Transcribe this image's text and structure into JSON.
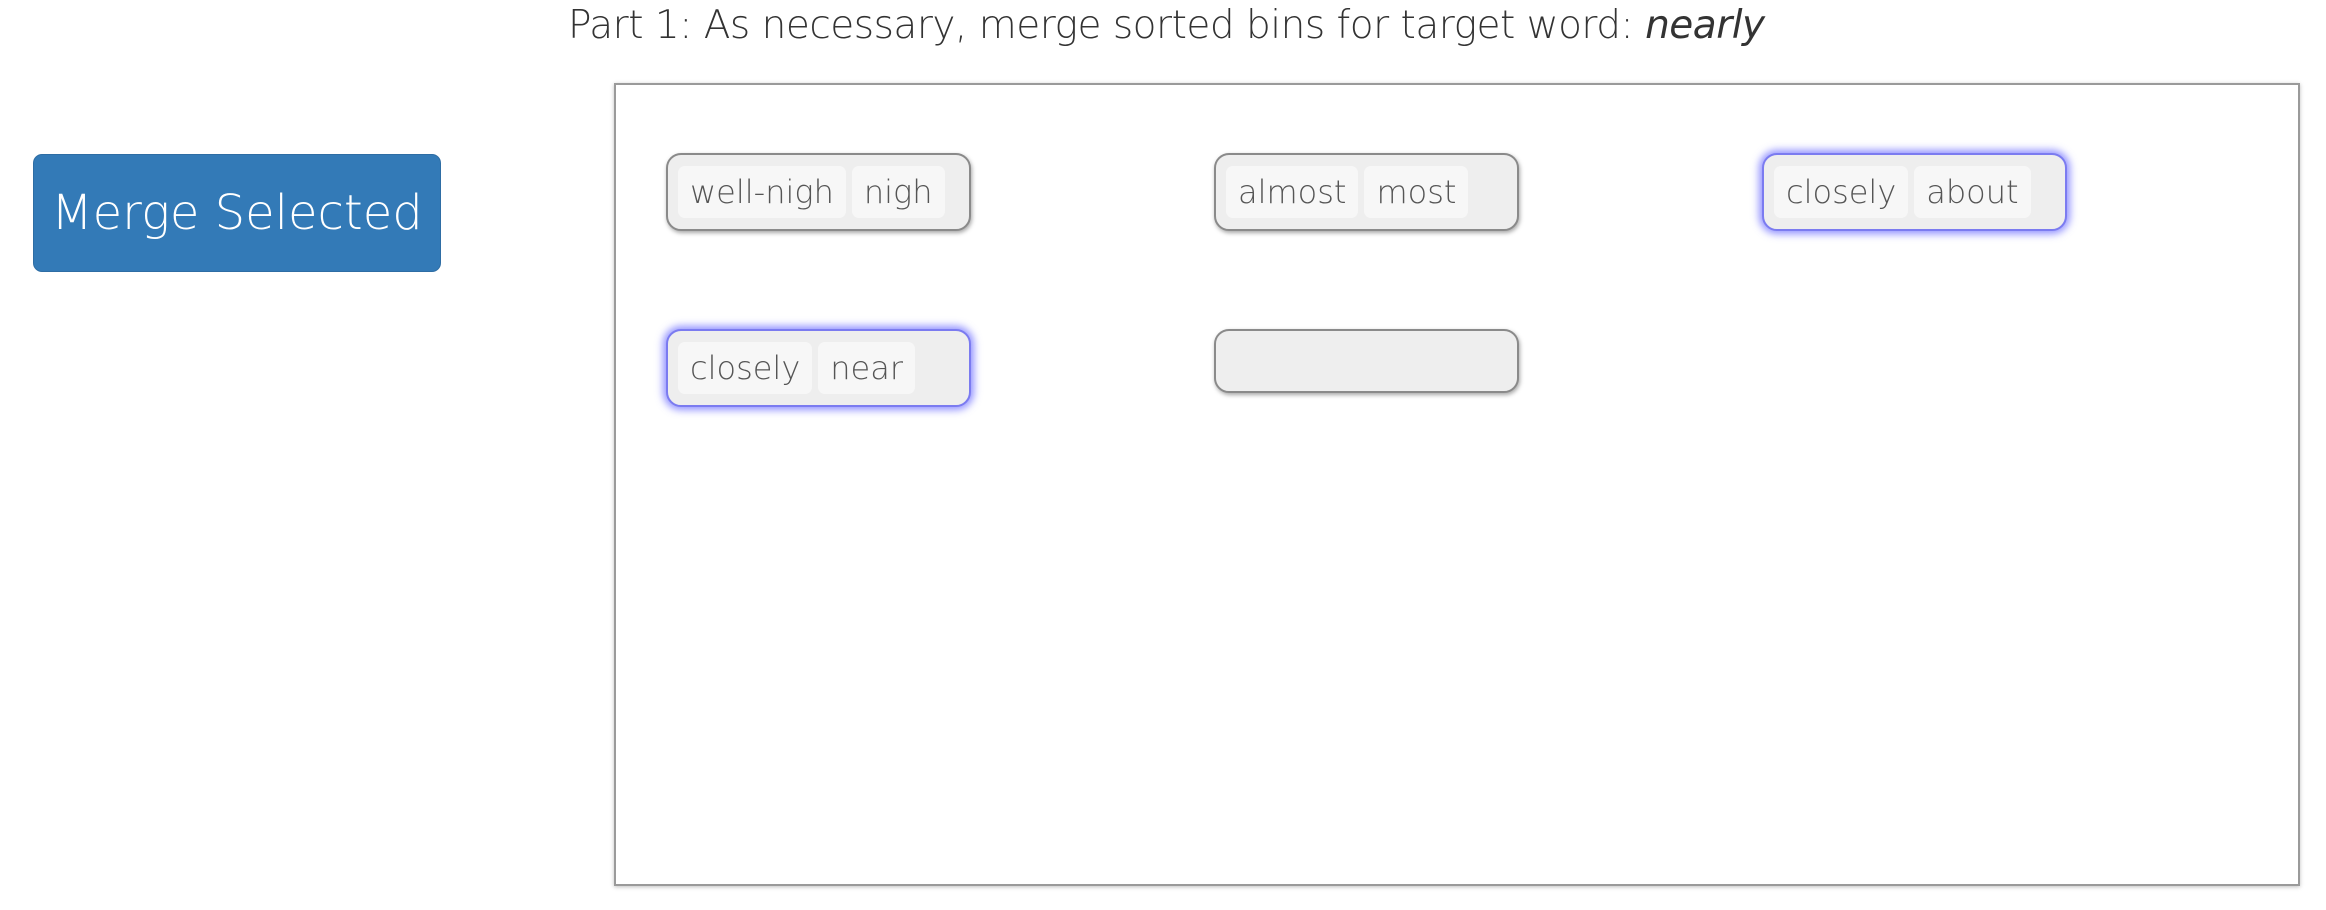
{
  "header": {
    "instruction": "Part 1: As necessary, merge sorted bins for target word: ",
    "target_word": "nearly"
  },
  "toolbar": {
    "merge_label": "Merge Selected"
  },
  "bins": [
    {
      "words": [
        "well-nigh",
        "nigh"
      ],
      "selected": false
    },
    {
      "words": [
        "almost",
        "most"
      ],
      "selected": false
    },
    {
      "words": [
        "closely",
        "about"
      ],
      "selected": true
    },
    {
      "words": [
        "closely",
        "near"
      ],
      "selected": true
    },
    {
      "words": [],
      "selected": false
    }
  ],
  "colors": {
    "button_bg": "#337ab7",
    "bin_bg": "#eeeeee",
    "selected_glow": "#7b7bf0"
  }
}
